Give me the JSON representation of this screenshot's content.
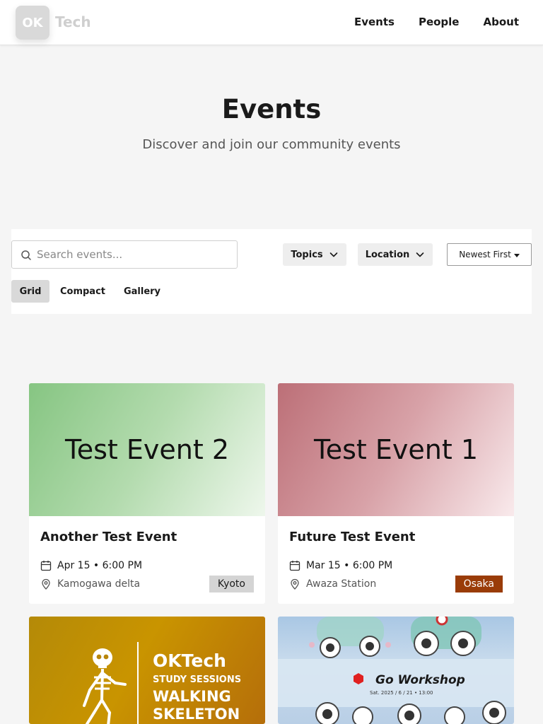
{
  "header": {
    "logo_mark": "OK",
    "logo_text": "Tech",
    "nav": [
      "Events",
      "People",
      "About"
    ]
  },
  "hero": {
    "title": "Events",
    "subtitle": "Discover and join our community events"
  },
  "filters": {
    "search_placeholder": "Search events...",
    "topics_label": "Topics",
    "location_label": "Location",
    "sort_label": "Newest First",
    "views": [
      "Grid",
      "Compact",
      "Gallery"
    ],
    "active_view": "Grid"
  },
  "events": [
    {
      "banner_text": "Test Event 2",
      "title": "Another Test Event",
      "date": "Apr 15 • 6:00 PM",
      "location": "Kamogawa delta",
      "city": "Kyoto",
      "city_color": "#d4d4d4",
      "city_text_color": "#1a1a1a"
    },
    {
      "banner_text": "Test Event 1",
      "title": "Future Test Event",
      "date": "Mar 15 • 6:00 PM",
      "location": "Awaza Station",
      "city": "Osaka",
      "city_color": "#9a3c08",
      "city_text_color": "#ffffff"
    },
    {
      "banner_brand": "OKTech",
      "banner_line1": "STUDY SESSIONS",
      "banner_line2": "WALKING",
      "banner_line3": "SKELETON"
    },
    {
      "banner_title": "Go Workshop",
      "banner_date": "Sat. 2025 / 6 / 21 • 13:00"
    }
  ],
  "colors": {
    "accent": "#1a1a1a",
    "page_bg": "#f5f5f5",
    "osaka_badge": "#9a3c08",
    "kyoto_badge": "#d4d4d4"
  }
}
